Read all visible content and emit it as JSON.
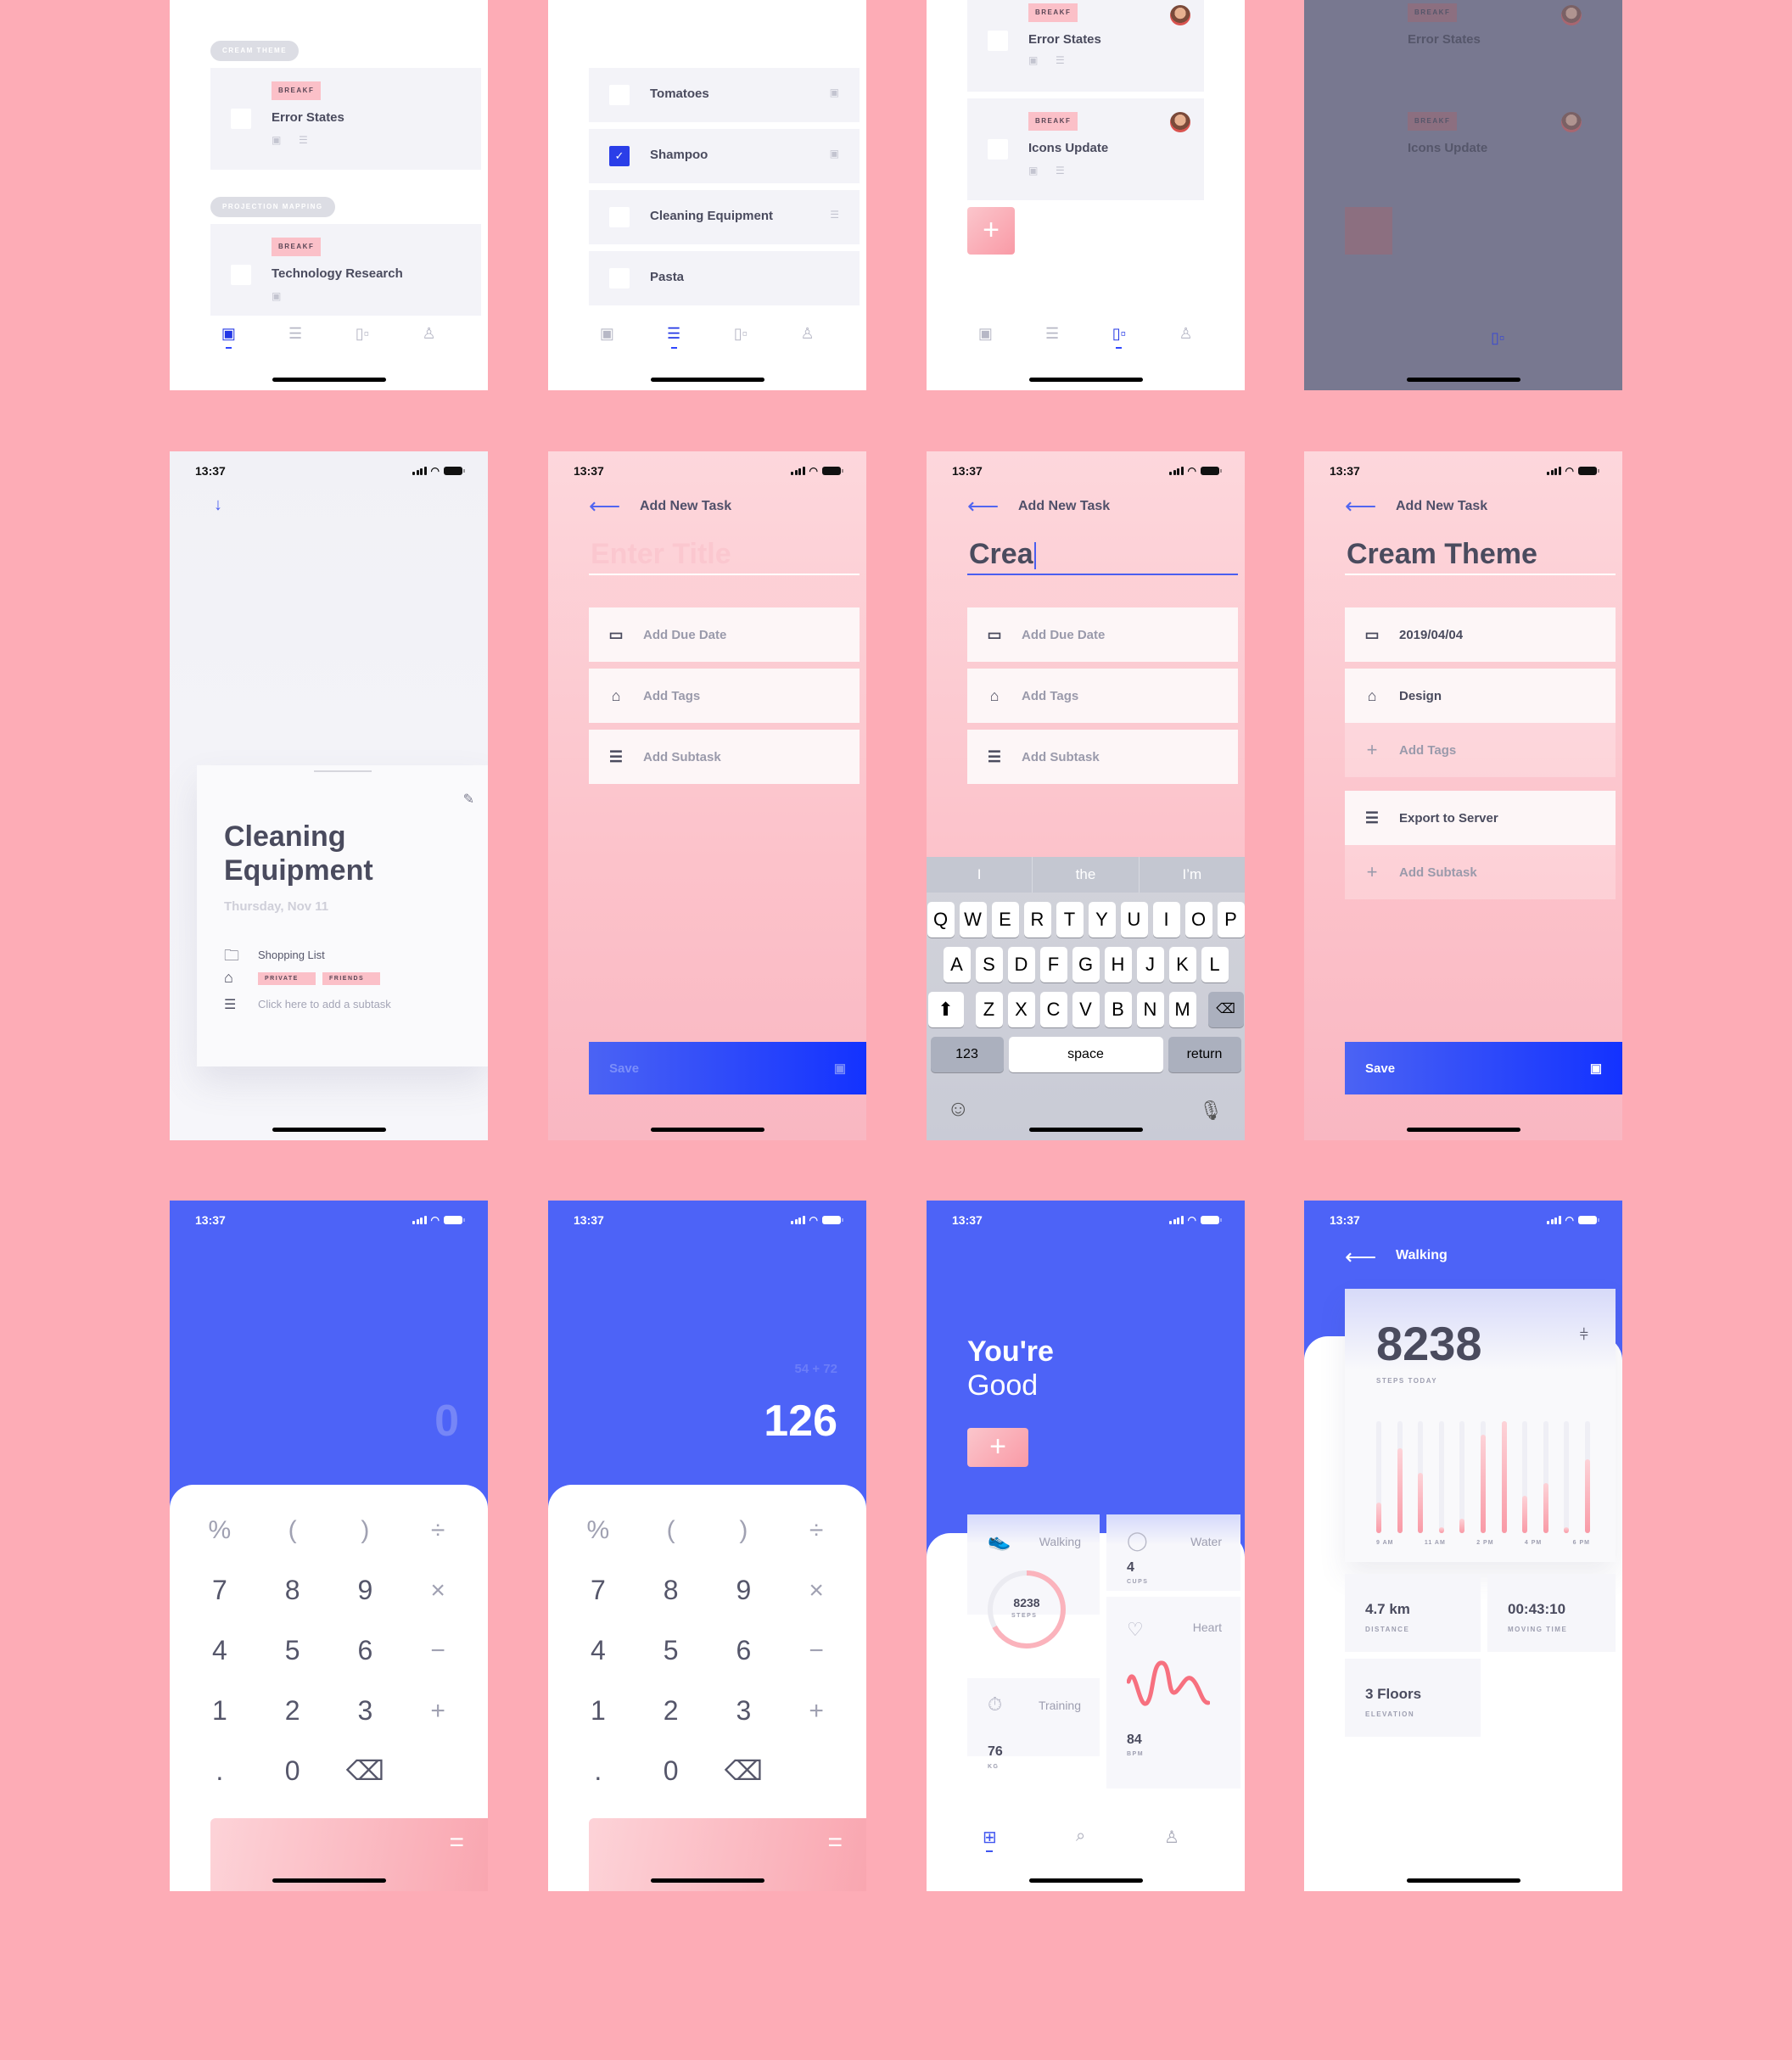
{
  "status": {
    "time": "13:37"
  },
  "colors": {
    "background": "#fdacb6",
    "accent": "#2f47ff",
    "pink": "#f99aa6",
    "text": "#4a4b5e"
  },
  "tabbar": {
    "tabs": [
      {
        "icon": "calendar-icon",
        "glyph": "▣"
      },
      {
        "icon": "list-icon",
        "glyph": "☰"
      },
      {
        "icon": "board-icon",
        "glyph": "▯▫"
      },
      {
        "icon": "profile-icon",
        "glyph": "♙"
      }
    ]
  },
  "screen_timeline": {
    "groups": [
      {
        "chip": "CREAM THEME",
        "task": {
          "tag": "BREAKF",
          "title": "Error States"
        }
      },
      {
        "chip": "PROJECTION MAPPING",
        "task": {
          "tag": "BREAKF",
          "title": "Technology Research"
        }
      }
    ]
  },
  "screen_list": {
    "items": [
      {
        "title": "Tomatoes",
        "checked": false,
        "meta_icon": "calendar-icon"
      },
      {
        "title": "Shampoo",
        "checked": true,
        "meta_icon": "calendar-icon"
      },
      {
        "title": "Cleaning Equipment",
        "checked": false,
        "meta_icon": "list-icon"
      },
      {
        "title": "Pasta",
        "checked": false,
        "meta_icon": ""
      }
    ]
  },
  "screen_board": {
    "cards": [
      {
        "tag": "BREAKF",
        "title": "Error States"
      },
      {
        "tag": "BREAKF",
        "title": "Icons Update"
      }
    ],
    "add_label": "+"
  },
  "screen_board_dimmed": {
    "cards": [
      {
        "tag": "BREAKF",
        "title": "Error States"
      },
      {
        "tag": "BREAKF",
        "title": "Icons Update"
      }
    ]
  },
  "screen_detail": {
    "title_line1": "Cleaning",
    "title_line2": "Equipment",
    "date": "Thursday, Nov 11",
    "list": "Shopping List",
    "tags": [
      "PRIVATE",
      "FRIENDS"
    ],
    "subtask_placeholder": "Click here to add a subtask"
  },
  "add_task": {
    "nav_title": "Add New Task",
    "title_placeholder": "Enter Title",
    "due_date": "Add Due Date",
    "tags": "Add Tags",
    "subtask": "Add Subtask",
    "save": "Save"
  },
  "add_task_typing": {
    "title_value": "Crea"
  },
  "keyboard": {
    "suggestions": [
      "I",
      "the",
      "I’m"
    ],
    "row1": [
      "Q",
      "W",
      "E",
      "R",
      "T",
      "Y",
      "U",
      "I",
      "O",
      "P"
    ],
    "row2": [
      "A",
      "S",
      "D",
      "F",
      "G",
      "H",
      "J",
      "K",
      "L"
    ],
    "row3": [
      "Z",
      "X",
      "C",
      "V",
      "B",
      "N",
      "M"
    ],
    "numbers": "123",
    "space": "space",
    "return": "return"
  },
  "add_task_filled": {
    "title_value": "Cream Theme",
    "due_date": "2019/04/04",
    "tag": "Design",
    "add_tags": "Add Tags",
    "subtask": "Export to Server",
    "add_subtask": "Add Subtask",
    "save": "Save"
  },
  "calculator": {
    "keys": [
      "%",
      "(",
      ")",
      "÷",
      "7",
      "8",
      "9",
      "×",
      "4",
      "5",
      "6",
      "−",
      "1",
      "2",
      "3",
      "+",
      ".",
      "0",
      "⌫",
      ""
    ],
    "equals": "=",
    "empty_display": "0",
    "expression": "54 + 72",
    "result": "126"
  },
  "health": {
    "greeting_line1": "You're",
    "greeting_line2": "Good",
    "walking": {
      "label": "Walking",
      "value": "8238",
      "unit": "STEPS",
      "progress": 0.67
    },
    "water": {
      "label": "Water",
      "value": "4",
      "unit": "CUPS"
    },
    "training": {
      "label": "Training",
      "value": "76",
      "unit": "KG"
    },
    "heart": {
      "label": "Heart",
      "value": "84",
      "unit": "BPM"
    }
  },
  "walking_detail": {
    "nav_title": "Walking",
    "steps": "8238",
    "steps_label": "STEPS TODAY",
    "x_labels": [
      "9 AM",
      "11 AM",
      "2 PM",
      "4 PM",
      "6 PM"
    ],
    "bar_fractions": [
      0.27,
      0.76,
      0.54,
      0.04,
      0.13,
      0.88,
      1.0,
      0.33,
      0.45,
      0.04,
      0.66
    ],
    "stats": [
      {
        "value": "4.7 km",
        "label": "DISTANCE"
      },
      {
        "value": "00:43:10",
        "label": "MOVING TIME"
      },
      {
        "value": "3 Floors",
        "label": "ELEVATION"
      }
    ]
  }
}
